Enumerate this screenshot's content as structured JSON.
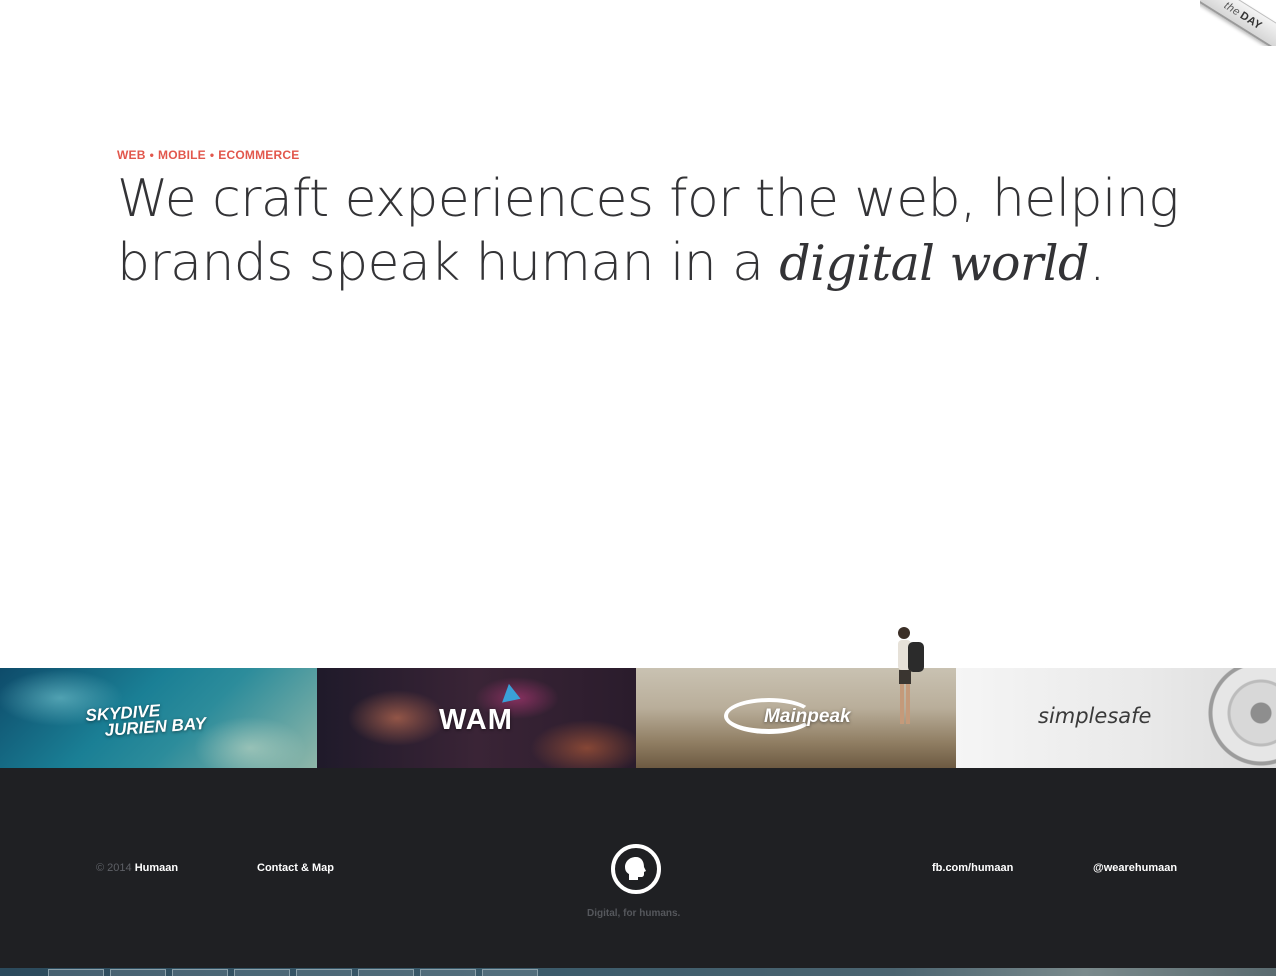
{
  "ribbon": {
    "the": "the",
    "day": "DAY"
  },
  "hero": {
    "tags": [
      "WEB",
      "MOBILE",
      "ECOMMERCE"
    ],
    "separator": "•",
    "headline_line1": "We craft experiences for the web, helping",
    "headline_line2_start": "brands speak human in a ",
    "headline_emphasis": "digital world",
    "headline_end": "."
  },
  "portfolio": [
    {
      "name": "skydive",
      "label_line1": "SKYDIVE",
      "label_line2": "JURIEN BAY"
    },
    {
      "name": "wam",
      "label": "WAM"
    },
    {
      "name": "mainpeak",
      "label": "Mainpeak"
    },
    {
      "name": "simplesafe",
      "label_a": "simple",
      "label_b": "safe"
    }
  ],
  "footer": {
    "copyright_symbol": "© 2014",
    "brand": "Humaan",
    "contact": "Contact & Map",
    "facebook": "fb.com/humaan",
    "twitter": "@wearehumaan",
    "slogan": "Digital, for humans."
  },
  "colors": {
    "accent": "#e2574c",
    "footer_bg": "#1f2023",
    "text_dark": "#333336"
  },
  "icons": [
    "human-head-logo-icon",
    "play-icon",
    "gear-icon"
  ]
}
